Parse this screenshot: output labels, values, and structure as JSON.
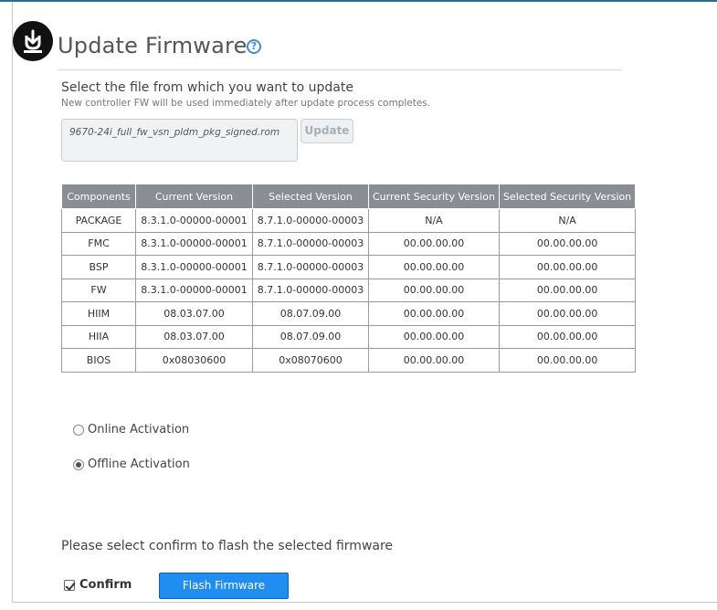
{
  "header": {
    "title": "Update Firmware",
    "icon": "firmware-upload-icon",
    "help": "?"
  },
  "file_section": {
    "label": "Select the file from which you want to update",
    "note": "New controller FW will be used immediately after update process completes.",
    "file_value": "9670-24i_full_fw_vsn_pldm_pkg_signed.rom",
    "update_label": "Update"
  },
  "table": {
    "headers": [
      "Components",
      "Current Version",
      "Selected Version",
      "Current Security Version",
      "Selected Security Version"
    ],
    "rows": [
      [
        "PACKAGE",
        "8.3.1.0-00000-00001",
        "8.7.1.0-00000-00003",
        "N/A",
        "N/A"
      ],
      [
        "FMC",
        "8.3.1.0-00000-00001",
        "8.7.1.0-00000-00003",
        "00.00.00.00",
        "00.00.00.00"
      ],
      [
        "BSP",
        "8.3.1.0-00000-00001",
        "8.7.1.0-00000-00003",
        "00.00.00.00",
        "00.00.00.00"
      ],
      [
        "FW",
        "8.3.1.0-00000-00001",
        "8.7.1.0-00000-00003",
        "00.00.00.00",
        "00.00.00.00"
      ],
      [
        "HIIM",
        "08.03.07.00",
        "08.07.09.00",
        "00.00.00.00",
        "00.00.00.00"
      ],
      [
        "HIIA",
        "08.03.07.00",
        "08.07.09.00",
        "00.00.00.00",
        "00.00.00.00"
      ],
      [
        "BIOS",
        "0x08030600",
        "0x08070600",
        "00.00.00.00",
        "00.00.00.00"
      ]
    ]
  },
  "activation": {
    "online_label": "Online Activation",
    "offline_label": "Offline Activation",
    "selected": "offline"
  },
  "confirm": {
    "prompt": "Please select confirm to flash the selected firmware",
    "checkbox_label": "Confirm",
    "checked": true,
    "flash_label": "Flash Firmware"
  },
  "colors": {
    "accent": "#1f8ef0",
    "table_header": "#8a8d91",
    "help": "#3a8edc"
  }
}
